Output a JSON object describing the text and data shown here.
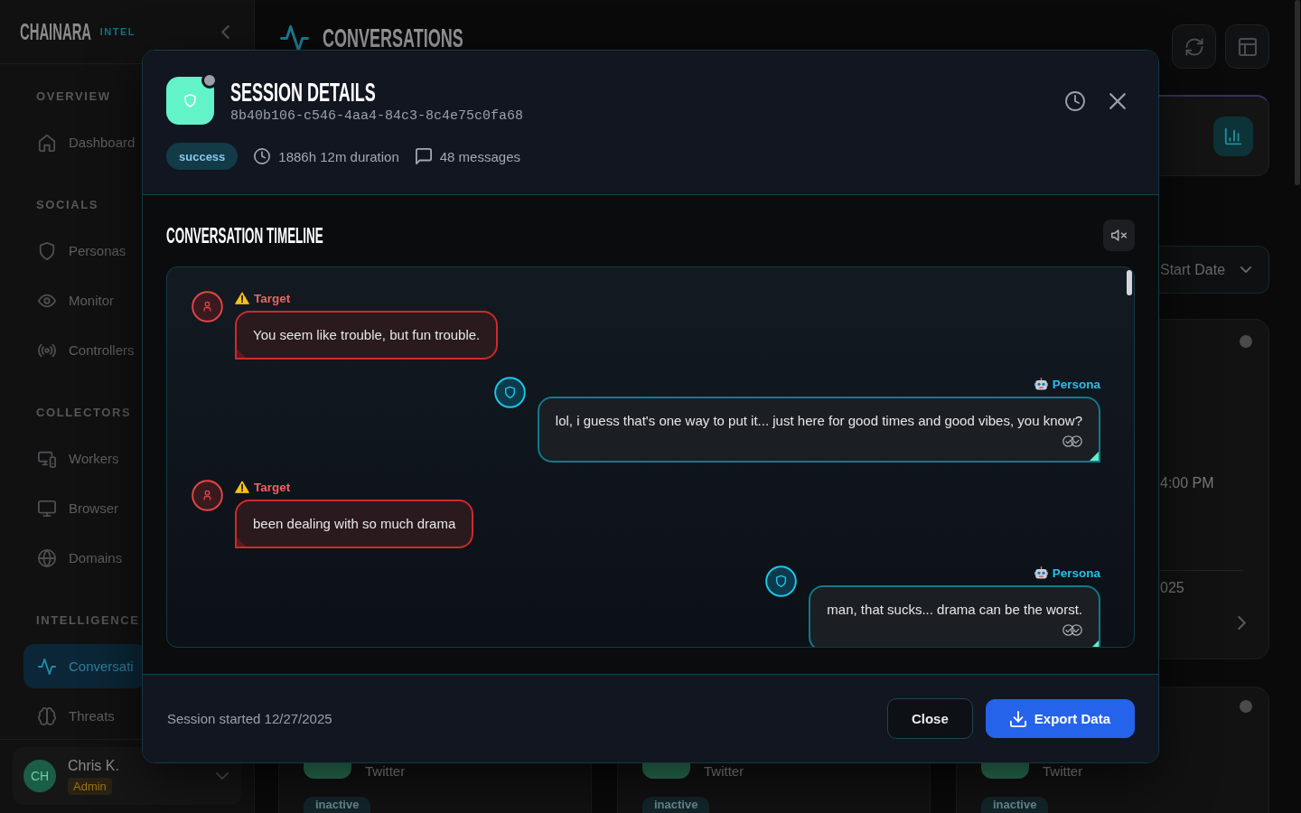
{
  "sidebar": {
    "brand": "CHAINARA",
    "brand_tag": "INTEL",
    "sections": [
      {
        "title": "OVERVIEW",
        "items": [
          {
            "label": "Dashboard",
            "selected": false
          }
        ]
      },
      {
        "title": "SOCIALS",
        "items": [
          {
            "label": "Personas",
            "selected": false
          },
          {
            "label": "Monitor",
            "selected": false
          },
          {
            "label": "Controllers",
            "selected": false
          }
        ]
      },
      {
        "title": "COLLECTORS",
        "items": [
          {
            "label": "Workers",
            "selected": false
          },
          {
            "label": "Browser",
            "selected": false
          },
          {
            "label": "Domains",
            "selected": false
          }
        ]
      },
      {
        "title": "INTELLIGENCE",
        "items": [
          {
            "label": "Conversati",
            "selected": true
          },
          {
            "label": "Threats",
            "selected": false
          }
        ]
      }
    ],
    "user": {
      "initials": "CH",
      "name": "Chris K.",
      "role": "Admin"
    }
  },
  "page": {
    "title": "CONVERSATIONS",
    "date_filter": {
      "label": "Start Date"
    },
    "cards": [
      {
        "active": false,
        "time": "4:00 PM",
        "date": "025"
      },
      {
        "platform": "Twitter",
        "status": "inactive"
      },
      {
        "platform": "Twitter",
        "status": "inactive"
      },
      {
        "active": false,
        "platform": "Twitter",
        "status": "inactive"
      }
    ]
  },
  "modal": {
    "title": "SESSION DETAILS",
    "session_id": "8b40b106-c546-4aa4-84c3-8c4e75c0fa68",
    "online": false,
    "status": "success",
    "duration": "1886h 12m duration",
    "message_count": "48 messages",
    "timeline": {
      "title": "CONVERSATION TIMELINE",
      "muted": true,
      "messages": [
        {
          "kind": "target",
          "sender": "Target",
          "text": "You seem like trouble, but fun trouble."
        },
        {
          "kind": "persona",
          "sender": "Persona",
          "text": "lol, i guess that's one way to put it... just here for good times and good vibes, you know?"
        },
        {
          "kind": "target",
          "sender": "Target",
          "text": "been dealing with so much drama"
        },
        {
          "kind": "persona",
          "sender": "Persona",
          "text": "man, that sucks... drama can be the worst."
        }
      ]
    },
    "footer": {
      "started": "Session started 12/27/2025",
      "buttons": [
        {
          "label": "Close",
          "kind": "secondary"
        },
        {
          "label": "Export Data",
          "kind": "primary"
        }
      ]
    }
  }
}
